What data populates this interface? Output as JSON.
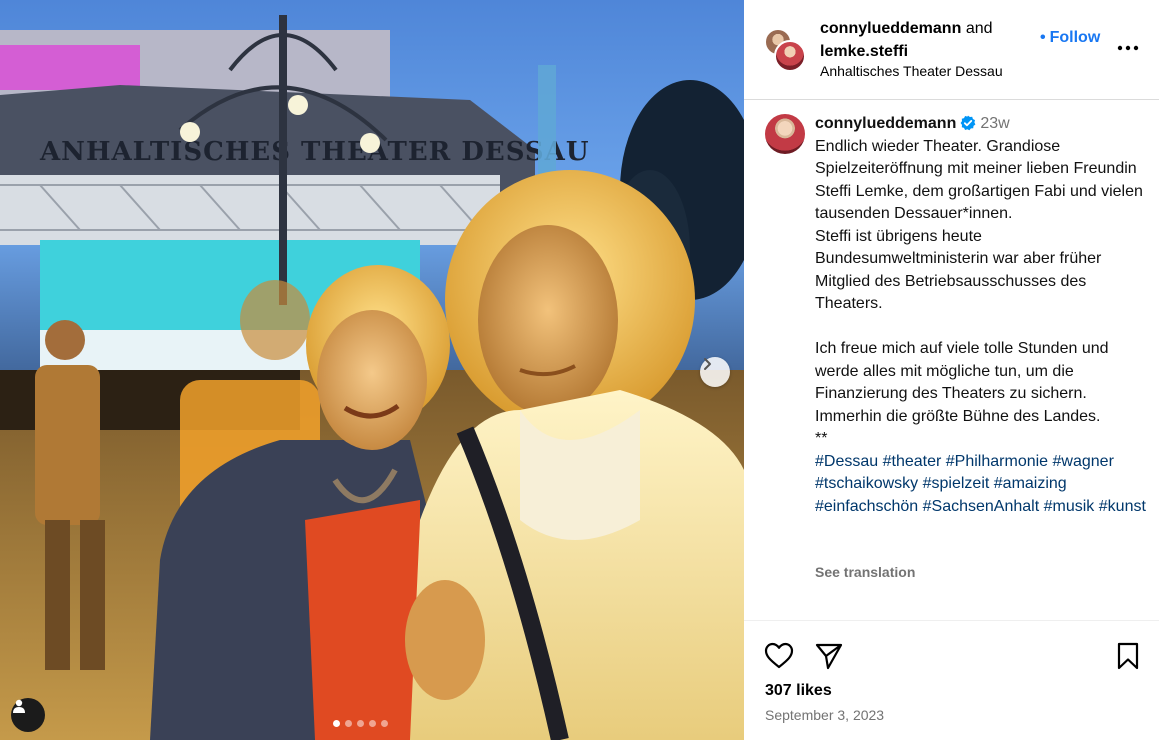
{
  "post": {
    "photo_alt": "",
    "carousel": {
      "total": 5,
      "active_index": 0
    }
  },
  "header": {
    "user1": "connylueddemann",
    "conjunction": "and",
    "user2": "lemke.steffi",
    "location": "Anhaltisches Theater Dessau",
    "follow_label": "Follow",
    "follow_color": "#1877f2"
  },
  "caption": {
    "username": "connylueddemann",
    "time": "23w",
    "text": "Endlich wieder Theater. Grandiose Spielzeiteröffnung mit meiner lieben Freundin Steffi Lemke, dem großartigen Fabi und vielen tausenden Dessauer*innen.\nSteffi ist übrigens heute Bundesumweltministerin war aber früher Mitglied des Betriebsausschusses des Theaters.\n\nIch freue mich auf viele tolle Stunden und werde alles mit mögliche tun, um die Finanzierung des Theaters zu sichern. Immerhin die größte Bühne des Landes.\n**",
    "hashtags": [
      "#Dessau",
      "#theater",
      "#Philharmonie",
      "#wagner",
      "#tschaikowsky",
      "#spielzeit",
      "#amaizing",
      "#einfachschön",
      "#SachsenAnhalt",
      "#musik",
      "#kunst"
    ],
    "see_translation": "See translation",
    "hashtag_color": "#00376b"
  },
  "stats": {
    "likes": "307 likes",
    "date": "September 3, 2023"
  },
  "photo_sign": "ANHALTISCHES THEATER DESSAU",
  "icons": {
    "like": "heart-icon",
    "share": "paper-plane-icon",
    "save": "bookmark-icon",
    "more": "more-horizontal-icon",
    "next": "chevron-right-icon",
    "tag": "user-tag-icon",
    "verified": "verified-badge-icon"
  }
}
